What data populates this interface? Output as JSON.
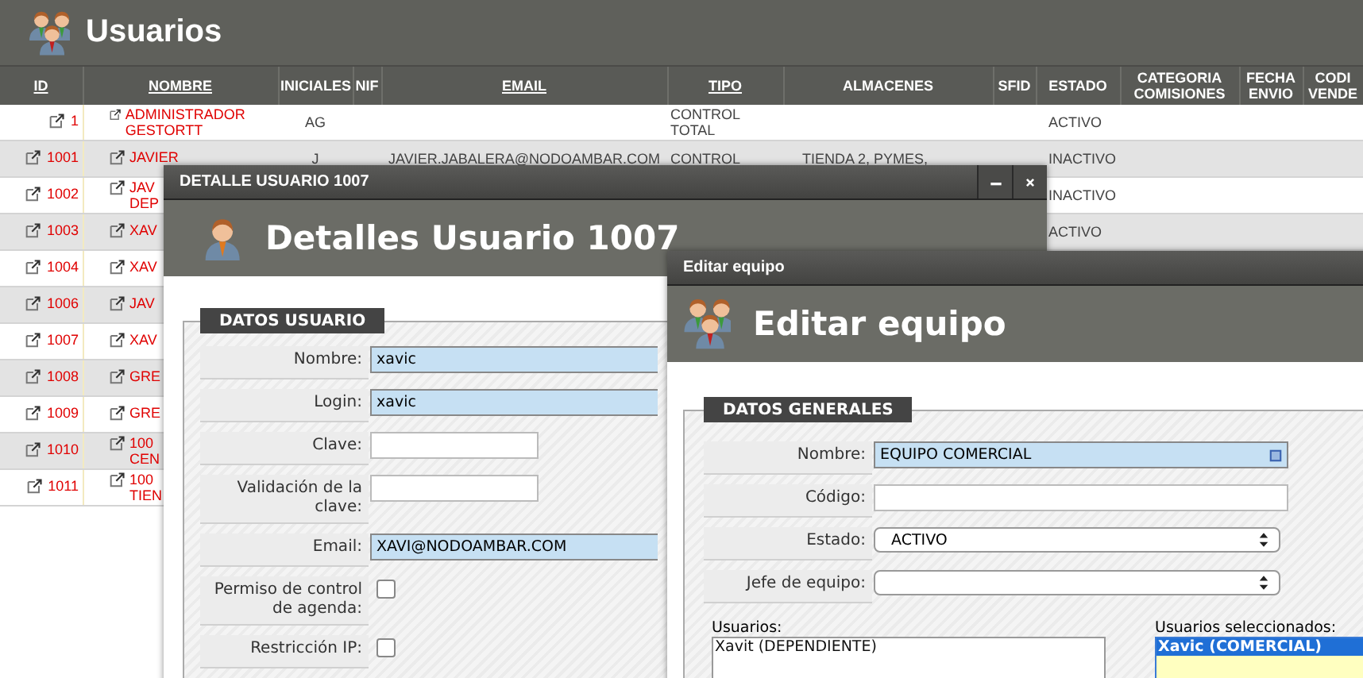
{
  "page": {
    "title": "Usuarios"
  },
  "table": {
    "columns": [
      {
        "label": "ID",
        "sortable": true,
        "kind": "link"
      },
      {
        "label": "NOMBRE",
        "sortable": true,
        "kind": "link"
      },
      {
        "label": "INICIALES",
        "sortable": false,
        "kind": "text"
      },
      {
        "label": "NIF",
        "sortable": false
      },
      {
        "label": "EMAIL",
        "sortable": true,
        "kind": "text"
      },
      {
        "label": "TIPO",
        "sortable": true,
        "kind": "text"
      },
      {
        "label": "ALMACENES",
        "sortable": false,
        "kind": "text"
      },
      {
        "label": "SFID",
        "sortable": false
      },
      {
        "label": "ESTADO",
        "sortable": false,
        "kind": "text"
      },
      {
        "label": "CATEGORIA COMISIONES",
        "sortable": false
      },
      {
        "label": "FECHA ENVIO",
        "sortable": false
      },
      {
        "label": "CODI VENDE",
        "sortable": false
      }
    ],
    "rows": [
      {
        "id": "1",
        "nombre": "ADMINISTRADOR GESTORTT",
        "iniciales": "AG",
        "tipo": "CONTROL TOTAL",
        "estado": "ACTIVO"
      },
      {
        "id": "1001",
        "nombre": "JAVIER",
        "iniciales": "J",
        "email": "JAVIER.JABALERA@NODOAMBAR.COM",
        "tipo": "CONTROL",
        "almacenes": "TIENDA 2, PYMES,",
        "estado": "INACTIVO"
      },
      {
        "id": "1002",
        "nombre": "JAV\nDEP",
        "estado": "INACTIVO"
      },
      {
        "id": "1003",
        "nombre": "XAV",
        "estado": "ACTIVO"
      },
      {
        "id": "1004",
        "nombre": "XAV"
      },
      {
        "id": "1006",
        "nombre": "JAV"
      },
      {
        "id": "1007",
        "nombre": "XAV"
      },
      {
        "id": "1008",
        "nombre": "GRE"
      },
      {
        "id": "1009",
        "nombre": "GRE"
      },
      {
        "id": "1010",
        "nombre": "100\nCEN"
      },
      {
        "id": "1011",
        "nombre": "100\nTIEN"
      }
    ]
  },
  "user_window": {
    "title": "DETALLE USUARIO 1007",
    "heading": "Detalles Usuario 1007",
    "section": "DATOS USUARIO",
    "fields": [
      {
        "label": "Nombre:",
        "kind": "text",
        "value": "xavic"
      },
      {
        "label": "Login:",
        "kind": "text",
        "value": "xavic"
      },
      {
        "label": "Clave:",
        "kind": "text"
      },
      {
        "label": "Validación de la clave:",
        "kind": "text"
      },
      {
        "label": "Email:",
        "kind": "text",
        "value": "XAVI@NODOAMBAR.COM"
      },
      {
        "label": "Permiso de control de agenda:",
        "kind": "checkbox",
        "checked": false
      },
      {
        "label": "Restricción IP:",
        "kind": "checkbox",
        "checked": false
      }
    ]
  },
  "team_window": {
    "title": "Editar equipo",
    "heading": "Editar equipo",
    "section": "DATOS GENERALES",
    "fields": [
      {
        "label": "Nombre:",
        "kind": "text",
        "value": "EQUIPO COMERCIAL"
      },
      {
        "label": "Código:",
        "kind": "text"
      },
      {
        "label": "Estado:",
        "kind": "select",
        "value": "ACTIVO"
      },
      {
        "label": "Jefe de equipo:",
        "kind": "select"
      }
    ],
    "lists": [
      {
        "label": "Usuarios:",
        "items": [
          {
            "label": "Xavit (DEPENDIENTE)",
            "selected": false
          }
        ]
      },
      {
        "label": "Usuarios seleccionados:",
        "items": [
          {
            "label": "Xavic (COMERCIAL)",
            "selected": true
          }
        ]
      }
    ]
  }
}
